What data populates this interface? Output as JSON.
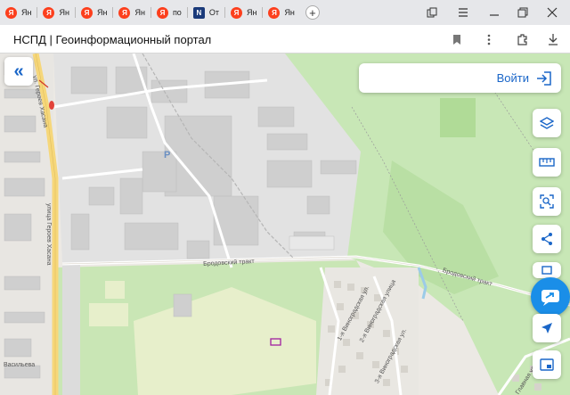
{
  "browser": {
    "tabs": [
      {
        "label": "Ян",
        "icon": "yandex-icon"
      },
      {
        "label": "Ян",
        "icon": "yandex-icon"
      },
      {
        "label": "Ян",
        "icon": "yandex-icon"
      },
      {
        "label": "Ян",
        "icon": "yandex-icon"
      },
      {
        "label": "по",
        "icon": "yandex-icon"
      },
      {
        "label": "От",
        "icon": "nspd-icon"
      },
      {
        "label": "Ян",
        "icon": "yandex-icon"
      },
      {
        "label": "Ян",
        "icon": "yandex-icon"
      }
    ],
    "yandex_letter": "Я",
    "nspd_letter": "N",
    "page_title": "НСПД | Геоинформационный портал"
  },
  "portal": {
    "login_label": "Войти"
  },
  "map": {
    "streets": {
      "geroev_hasana_top": "ул. Героев Хасана",
      "geroev_hasana_bottom": "улица Героев Хасана",
      "brodovsky_1": "Бродовский тракт",
      "brodovsky_2": "Бродовский тракт",
      "vinogradskaya_1": "1-я Виноградская ул.",
      "vinogradskaya_2": "2-я Виноградская улица",
      "vinogradskaya_3": "3-я Виноградская ул.",
      "vasilyeva": "Васильева",
      "glavnaya": "Главная улица"
    },
    "markers": {
      "parking": "P"
    }
  },
  "colors": {
    "accent": "#1a66c8",
    "fab": "#1a8ee8",
    "forest": "#c6e6b4",
    "meadow": "#e4edc8",
    "industrial": "#e3e3e3",
    "building": "#cfcfcf",
    "road": "#ffffff",
    "main_road": "#f6d77a",
    "parcel_outline": "#a020a0"
  }
}
